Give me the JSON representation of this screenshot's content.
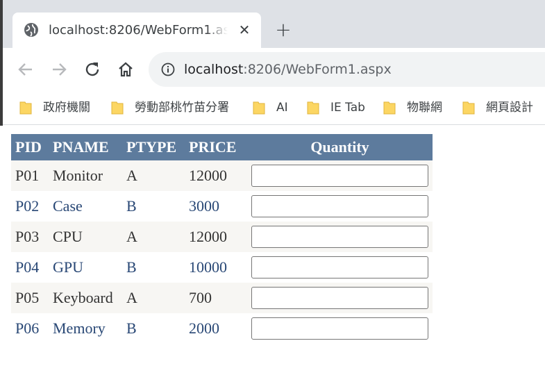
{
  "browser": {
    "tab": {
      "title": "localhost:8206/WebForm1.aspx",
      "favicon": "globe-icon",
      "close_icon": "close-icon"
    },
    "new_tab_icon": "plus-icon",
    "toolbar": {
      "back_icon": "arrow-left-icon",
      "forward_icon": "arrow-right-icon",
      "reload_icon": "reload-icon",
      "home_icon": "home-icon",
      "site_info_icon": "info-icon",
      "url_host": "localhost",
      "url_rest": ":8206/WebForm1.aspx"
    },
    "bookmarks": [
      {
        "label": "政府機關",
        "icon": "folder-icon"
      },
      {
        "label": "勞動部桃竹苗分署",
        "icon": "folder-icon"
      },
      {
        "label": "AI",
        "icon": "folder-icon"
      },
      {
        "label": "IE Tab",
        "icon": "folder-icon"
      },
      {
        "label": "物聯網",
        "icon": "folder-icon"
      },
      {
        "label": "網頁設計",
        "icon": "folder-icon"
      }
    ]
  },
  "grid": {
    "headers": [
      "PID",
      "PNAME",
      "PTYPE",
      "PRICE",
      "Quantity"
    ],
    "rows": [
      {
        "pid": "P01",
        "pname": "Monitor",
        "ptype": "A",
        "price": "12000",
        "quantity": ""
      },
      {
        "pid": "P02",
        "pname": "Case",
        "ptype": "B",
        "price": "3000",
        "quantity": ""
      },
      {
        "pid": "P03",
        "pname": "CPU",
        "ptype": "A",
        "price": "12000",
        "quantity": ""
      },
      {
        "pid": "P04",
        "pname": "GPU",
        "ptype": "B",
        "price": "10000",
        "quantity": ""
      },
      {
        "pid": "P05",
        "pname": "Keyboard",
        "ptype": "A",
        "price": "700",
        "quantity": ""
      },
      {
        "pid": "P06",
        "pname": "Memory",
        "ptype": "B",
        "price": "2000",
        "quantity": ""
      }
    ]
  },
  "colors": {
    "header_bg": "#5d7b9d",
    "odd_row_bg": "#f7f6f3",
    "odd_row_text": "#333333",
    "even_row_text": "#284775",
    "folder_yellow": "#fcd663"
  }
}
